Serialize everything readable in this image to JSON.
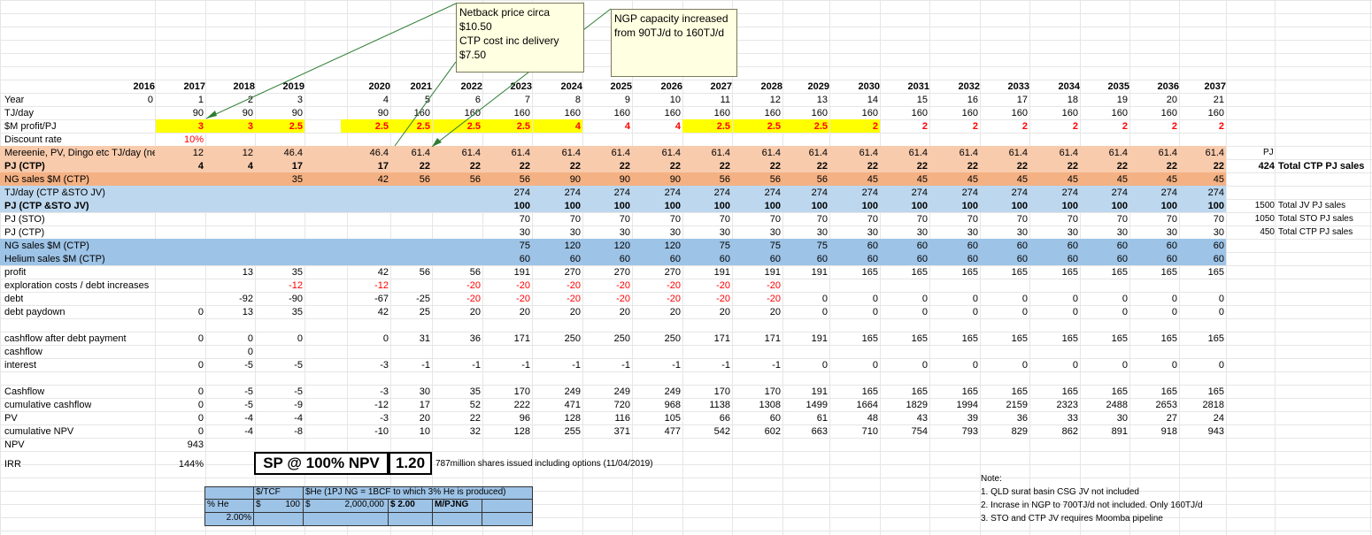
{
  "years_header": [
    "2016",
    "2017",
    "2018",
    "2019",
    "2020",
    "2021",
    "2022",
    "2023",
    "2024",
    "2025",
    "2026",
    "2027",
    "2028",
    "2029",
    "2030",
    "2031",
    "2032",
    "2033",
    "2034",
    "2035",
    "2036",
    "2037"
  ],
  "callouts": {
    "netback": [
      "Netback price circa",
      "$10.50",
      "CTP cost inc delivery",
      "$7.50"
    ],
    "ngp": [
      "NGP capacity increased",
      "from 90TJ/d to 160TJ/d"
    ]
  },
  "rows": [
    {
      "label": "Year",
      "vals": [
        "0",
        "1",
        "2",
        "3",
        "4",
        "5",
        "6",
        "7",
        "8",
        "9",
        "10",
        "11",
        "12",
        "13",
        "14",
        "15",
        "16",
        "17",
        "18",
        "19",
        "20",
        "21"
      ]
    },
    {
      "label": "TJ/day",
      "vals": [
        "",
        "90",
        "90",
        "90",
        "90",
        "160",
        "160",
        "160",
        "160",
        "160",
        "160",
        "160",
        "160",
        "160",
        "160",
        "160",
        "160",
        "160",
        "160",
        "160",
        "160",
        "160"
      ]
    },
    {
      "label": "$M profit/PJ",
      "vals": [
        "",
        "3",
        "3",
        "2.5",
        "2.5",
        "2.5",
        "2.5",
        "2.5",
        "4",
        "4",
        "4",
        "2.5",
        "2.5",
        "2.5",
        "2",
        "2",
        "2",
        "2",
        "2",
        "2",
        "2",
        "2"
      ]
    },
    {
      "label": "Discount rate",
      "vals": [
        "",
        "10%",
        "",
        "",
        "",
        "",
        "",
        "",
        "",
        "",
        "",
        "",
        "",
        "",
        "",
        "",
        "",
        "",
        "",
        "",
        "",
        ""
      ]
    },
    {
      "label": "Mereenie, PV, Dingo etc TJ/day (net",
      "vals": [
        "",
        "12",
        "12",
        "46.4",
        "46.4",
        "61.4",
        "61.4",
        "61.4",
        "61.4",
        "61.4",
        "61.4",
        "61.4",
        "61.4",
        "61.4",
        "61.4",
        "61.4",
        "61.4",
        "61.4",
        "61.4",
        "61.4",
        "61.4",
        "61.4"
      ]
    },
    {
      "label": "PJ (CTP)",
      "vals": [
        "",
        "4",
        "4",
        "17",
        "17",
        "22",
        "22",
        "22",
        "22",
        "22",
        "22",
        "22",
        "22",
        "22",
        "22",
        "22",
        "22",
        "22",
        "22",
        "22",
        "22",
        "22"
      ]
    },
    {
      "label": "NG sales $M (CTP)",
      "vals": [
        "",
        "",
        "",
        "35",
        "42",
        "56",
        "56",
        "56",
        "90",
        "90",
        "90",
        "56",
        "56",
        "56",
        "45",
        "45",
        "45",
        "45",
        "45",
        "45",
        "45",
        "45"
      ]
    },
    {
      "label": "TJ/day (CTP &STO JV)",
      "vals": [
        "",
        "",
        "",
        "",
        "",
        "",
        "",
        "274",
        "274",
        "274",
        "274",
        "274",
        "274",
        "274",
        "274",
        "274",
        "274",
        "274",
        "274",
        "274",
        "274",
        "274"
      ]
    },
    {
      "label": "PJ (CTP &STO JV)",
      "vals": [
        "",
        "",
        "",
        "",
        "",
        "",
        "",
        "100",
        "100",
        "100",
        "100",
        "100",
        "100",
        "100",
        "100",
        "100",
        "100",
        "100",
        "100",
        "100",
        "100",
        "100"
      ]
    },
    {
      "label": "PJ (STO)",
      "vals": [
        "",
        "",
        "",
        "",
        "",
        "",
        "",
        "70",
        "70",
        "70",
        "70",
        "70",
        "70",
        "70",
        "70",
        "70",
        "70",
        "70",
        "70",
        "70",
        "70",
        "70"
      ]
    },
    {
      "label": "PJ (CTP)",
      "vals": [
        "",
        "",
        "",
        "",
        "",
        "",
        "",
        "30",
        "30",
        "30",
        "30",
        "30",
        "30",
        "30",
        "30",
        "30",
        "30",
        "30",
        "30",
        "30",
        "30",
        "30"
      ]
    },
    {
      "label": "NG sales $M (CTP)",
      "vals": [
        "",
        "",
        "",
        "",
        "",
        "",
        "",
        "75",
        "120",
        "120",
        "120",
        "75",
        "75",
        "75",
        "60",
        "60",
        "60",
        "60",
        "60",
        "60",
        "60",
        "60"
      ]
    },
    {
      "label": "Helium sales  $M (CTP)",
      "vals": [
        "",
        "",
        "",
        "",
        "",
        "",
        "",
        "60",
        "60",
        "60",
        "60",
        "60",
        "60",
        "60",
        "60",
        "60",
        "60",
        "60",
        "60",
        "60",
        "60",
        "60"
      ]
    },
    {
      "label": "profit",
      "vals": [
        "",
        "",
        "13",
        "35",
        "42",
        "56",
        "56",
        "191",
        "270",
        "270",
        "270",
        "191",
        "191",
        "191",
        "165",
        "165",
        "165",
        "165",
        "165",
        "165",
        "165",
        "165"
      ]
    },
    {
      "label": "exploration costs / debt increases",
      "vals": [
        "",
        "",
        "",
        "-12",
        "-12",
        "",
        "-20",
        "-20",
        "-20",
        "-20",
        "-20",
        "-20",
        "-20",
        "",
        "",
        "",
        "",
        "",
        "",
        "",
        "",
        ""
      ]
    },
    {
      "label": "debt",
      "vals": [
        "",
        "",
        "-92",
        "-90",
        "-67",
        "-25",
        "-20",
        "-20",
        "-20",
        "-20",
        "-20",
        "-20",
        "-20",
        "0",
        "0",
        "0",
        "0",
        "0",
        "0",
        "0",
        "0",
        "0"
      ]
    },
    {
      "label": "debt paydown",
      "vals": [
        "",
        "0",
        "13",
        "35",
        "42",
        "25",
        "20",
        "20",
        "20",
        "20",
        "20",
        "20",
        "20",
        "0",
        "0",
        "0",
        "0",
        "0",
        "0",
        "0",
        "0",
        "0"
      ]
    },
    {
      "label": "",
      "vals": [
        "",
        "",
        "",
        "",
        "",
        "",
        "",
        "",
        "",
        "",
        "",
        "",
        "",
        "",
        "",
        "",
        "",
        "",
        "",
        "",
        "",
        ""
      ]
    },
    {
      "label": "cashflow after debt payment",
      "vals": [
        "",
        "0",
        "0",
        "0",
        "0",
        "31",
        "36",
        "171",
        "250",
        "250",
        "250",
        "171",
        "171",
        "191",
        "165",
        "165",
        "165",
        "165",
        "165",
        "165",
        "165",
        "165"
      ]
    },
    {
      "label": "cashflow",
      "vals": [
        "",
        "",
        "0",
        "",
        "",
        "",
        "",
        "",
        "",
        "",
        "",
        "",
        "",
        "",
        "",
        "",
        "",
        "",
        "",
        "",
        "",
        ""
      ]
    },
    {
      "label": "interest",
      "vals": [
        "",
        "0",
        "-5",
        "-5",
        "-3",
        "-1",
        "-1",
        "-1",
        "-1",
        "-1",
        "-1",
        "-1",
        "-1",
        "0",
        "0",
        "0",
        "0",
        "0",
        "0",
        "0",
        "0",
        "0"
      ]
    },
    {
      "label": "",
      "vals": [
        "",
        "",
        "",
        "",
        "",
        "",
        "",
        "",
        "",
        "",
        "",
        "",
        "",
        "",
        "",
        "",
        "",
        "",
        "",
        "",
        "",
        ""
      ]
    },
    {
      "label": "Cashflow",
      "vals": [
        "",
        "0",
        "-5",
        "-5",
        "-3",
        "30",
        "35",
        "170",
        "249",
        "249",
        "249",
        "170",
        "170",
        "191",
        "165",
        "165",
        "165",
        "165",
        "165",
        "165",
        "165",
        "165"
      ]
    },
    {
      "label": "cumulative cashflow",
      "vals": [
        "",
        "0",
        "-5",
        "-9",
        "-12",
        "17",
        "52",
        "222",
        "471",
        "720",
        "968",
        "1138",
        "1308",
        "1499",
        "1664",
        "1829",
        "1994",
        "2159",
        "2323",
        "2488",
        "2653",
        "2818"
      ]
    },
    {
      "label": "PV",
      "vals": [
        "",
        "0",
        "-4",
        "-4",
        "-3",
        "20",
        "22",
        "96",
        "128",
        "116",
        "105",
        "66",
        "60",
        "61",
        "48",
        "43",
        "39",
        "36",
        "33",
        "30",
        "27",
        "24"
      ]
    },
    {
      "label": "cumulative NPV",
      "vals": [
        "",
        "0",
        "-4",
        "-8",
        "-10",
        "10",
        "32",
        "128",
        "255",
        "371",
        "477",
        "542",
        "602",
        "663",
        "710",
        "754",
        "793",
        "829",
        "862",
        "891",
        "918",
        "943"
      ]
    },
    {
      "label": "NPV",
      "vals": [
        "",
        "943",
        "",
        "",
        "",
        "",
        "",
        "",
        "",
        "",
        "",
        "",
        "",
        "",
        "",
        "",
        "",
        "",
        "",
        "",
        "",
        ""
      ]
    }
  ],
  "side_labels": {
    "pj_header": "PJ",
    "total_ctp_value": "424",
    "total_ctp_label": "Total CTP PJ sales",
    "jv_value": "1500",
    "jv_label": "Total JV PJ sales",
    "sto_value": "1050",
    "sto_label": "Total STO PJ sales",
    "ctp_value": "450",
    "ctp_label": "Total CTP PJ sales"
  },
  "irr": {
    "label": "IRR",
    "value": "144%"
  },
  "sp_box": {
    "label": "SP @ 100% NPV",
    "value": "1.20",
    "note": "787million shares issued including options (11/04/2019)"
  },
  "he_table": {
    "h1": "$/TCF",
    "h2": "$He (1PJ NG = 1BCF to which 3% He is produced)",
    "row_label": "% He",
    "c1": "$",
    "c2": "100",
    "c3": "$",
    "c4": "2,000,000",
    "c5": "$  2.00",
    "c6": "M/PJNG",
    "pct": "2.00%"
  },
  "notes": [
    "Note:",
    "1. QLD surat basin CSG JV not included",
    "2. Incrase in NGP to 700TJ/d not included. Only 160TJ/d",
    "3. STO and CTP JV requires Moomba pipeline"
  ],
  "colors": {
    "peach": "#f8cbad",
    "orange": "#f4b183",
    "lightblue": "#bdd7ee",
    "midblue": "#9dc3e6",
    "yellow": "#ffff00",
    "note_bg": "#ffffe1"
  }
}
